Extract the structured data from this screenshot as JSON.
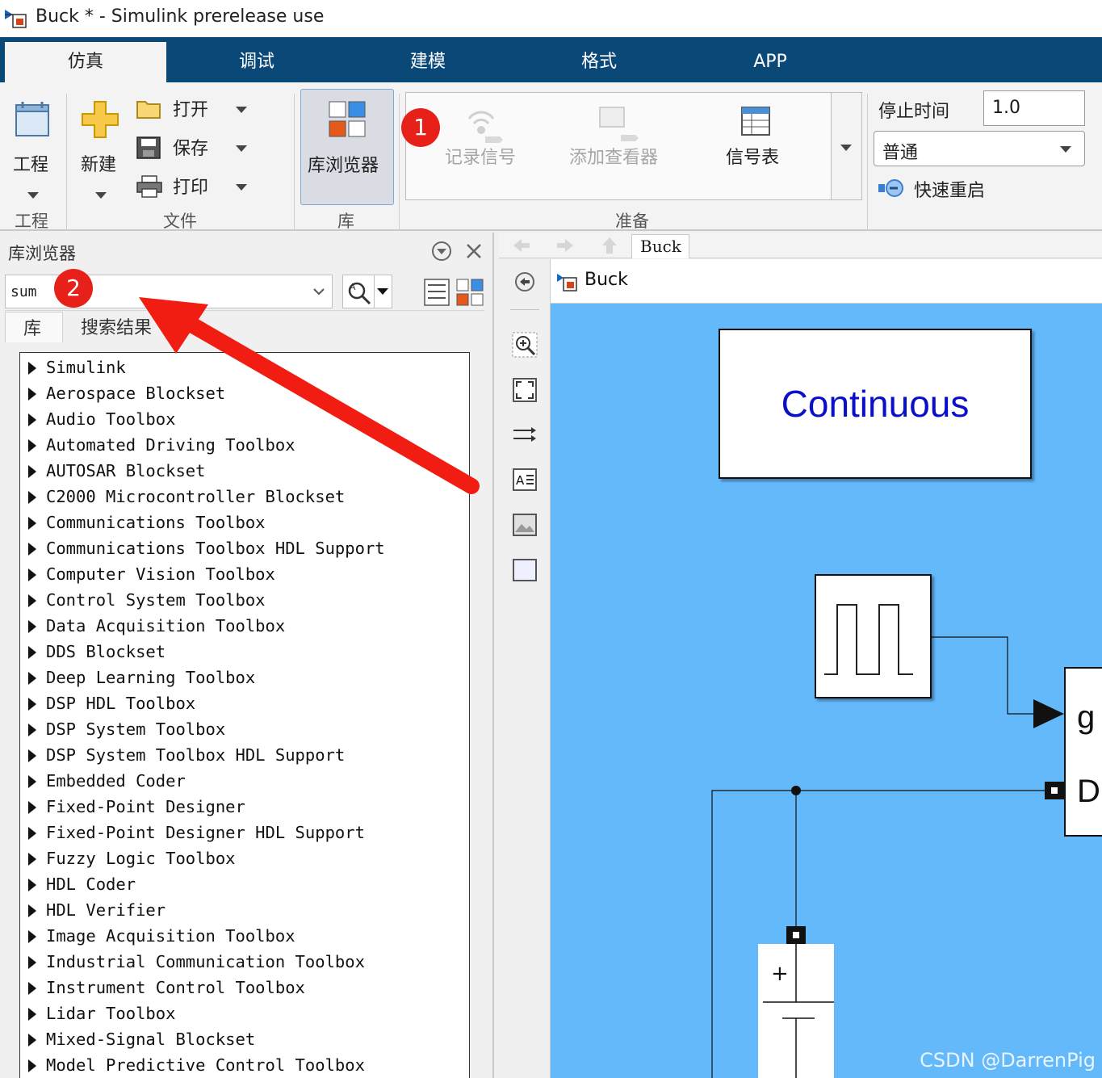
{
  "window": {
    "title": "Buck * - Simulink prerelease use"
  },
  "tabs": [
    {
      "label": "仿真",
      "active": true
    },
    {
      "label": "调试",
      "active": false
    },
    {
      "label": "建模",
      "active": false
    },
    {
      "label": "格式",
      "active": false
    },
    {
      "label": "APP",
      "active": false
    }
  ],
  "toolstrip": {
    "project": {
      "button": "工程",
      "section": "工程"
    },
    "file": {
      "new": "新建",
      "open": "打开",
      "save": "保存",
      "print": "打印",
      "section": "文件"
    },
    "library": {
      "browser": "库浏览器",
      "section": "库"
    },
    "prepare": {
      "log_signals": "记录信号",
      "add_viewer": "添加查看器",
      "signal_table": "信号表",
      "section": "准备"
    },
    "simulate": {
      "stop_time_label": "停止时间",
      "stop_time_value": "1.0",
      "mode": "普通",
      "fast_restart": "快速重启"
    }
  },
  "library_browser": {
    "title": "库浏览器",
    "search_value": "sum",
    "tabs": [
      "库",
      "搜索结果"
    ],
    "items": [
      "Simulink",
      "Aerospace Blockset",
      "Audio Toolbox",
      "Automated Driving Toolbox",
      "AUTOSAR Blockset",
      "C2000 Microcontroller Blockset",
      "Communications Toolbox",
      "Communications Toolbox HDL Support",
      "Computer Vision Toolbox",
      "Control System Toolbox",
      "Data Acquisition Toolbox",
      "DDS Blockset",
      "Deep Learning Toolbox",
      "DSP HDL Toolbox",
      "DSP System Toolbox",
      "DSP System Toolbox HDL Support",
      "Embedded Coder",
      "Fixed-Point Designer",
      "Fixed-Point Designer HDL Support",
      "Fuzzy Logic Toolbox",
      "HDL Coder",
      "HDL Verifier",
      "Image Acquisition Toolbox",
      "Industrial Communication Toolbox",
      "Instrument Control Toolbox",
      "Lidar Toolbox",
      "Mixed-Signal Blockset",
      "Model Predictive Control Toolbox"
    ]
  },
  "editor": {
    "breadcrumb_tab": "Buck",
    "model_path": "Buck",
    "blocks": {
      "powergui_text": "Continuous",
      "gate_port": "g",
      "drain_port": "D",
      "battery_plus": "+"
    },
    "canvas_color": "#64b9fb"
  },
  "annotations": {
    "badge1": "1",
    "badge2": "2",
    "badge_color": "#e8201a"
  },
  "watermark": "CSDN @DarrenPig"
}
